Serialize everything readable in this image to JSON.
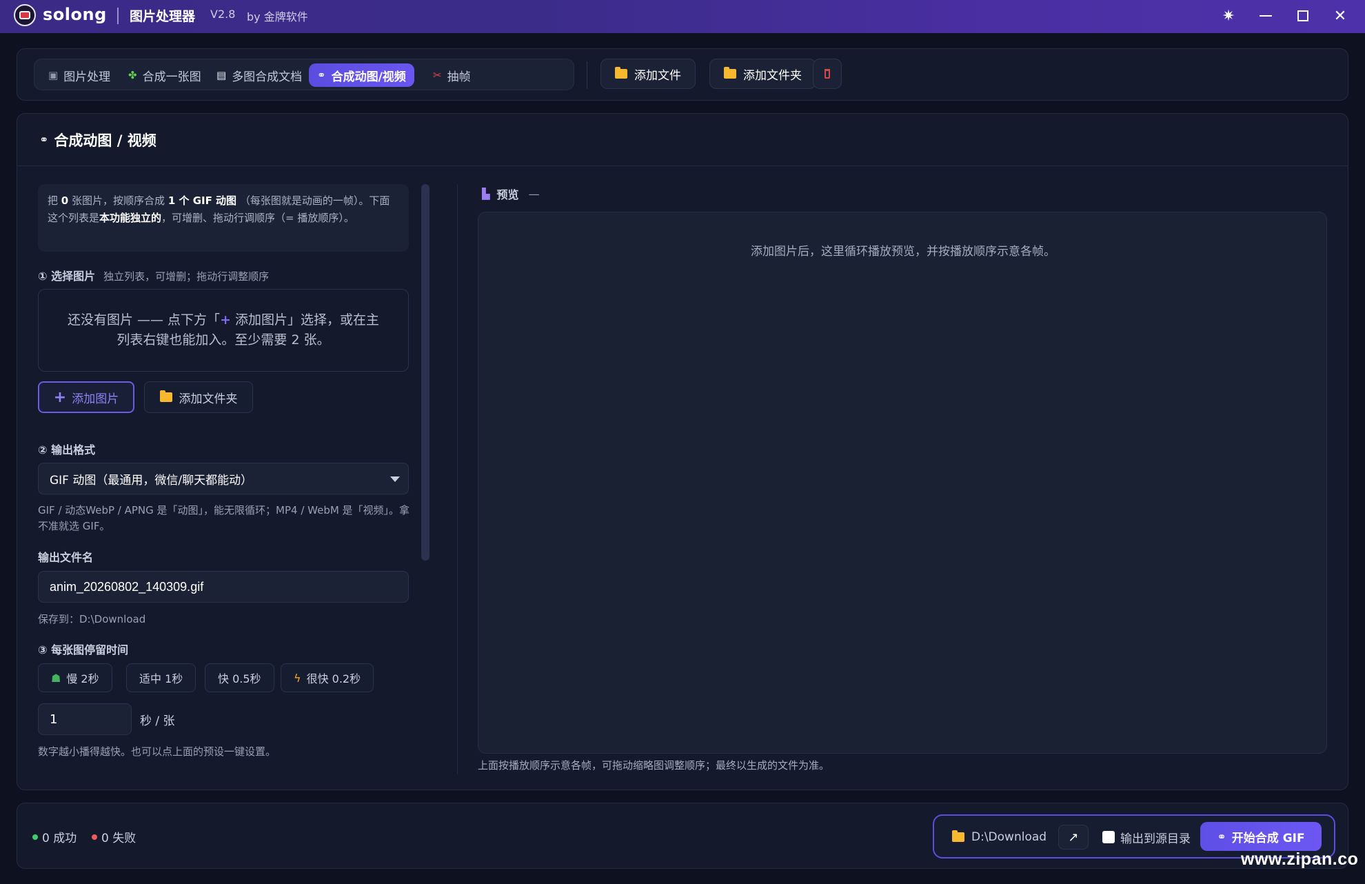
{
  "titlebar": {
    "app_name": "solong",
    "title": "图片处理器",
    "version": "V2.8",
    "by": "by 金牌软件",
    "accent": "#3b2a86"
  },
  "toolbar": {
    "tabs": [
      {
        "label": "图片处理",
        "icon": "image-icon"
      },
      {
        "label": "合成一张图",
        "icon": "puzzle-icon"
      },
      {
        "label": "多图合成文档",
        "icon": "document-icon"
      },
      {
        "label": "合成动图/视频",
        "icon": "link-icon",
        "active": true
      },
      {
        "label": "抽帧",
        "icon": "scissors-icon"
      }
    ],
    "add_file": "添加文件",
    "add_folder": "添加文件夹"
  },
  "main": {
    "title": "合成动图 / 视频",
    "info": {
      "p1": "把",
      "count": "0",
      "p2": "张图片，按顺序合成",
      "target": "1 个 GIF 动图",
      "p3": "（每张图就是动画的一帧）。下面这个列表是",
      "bold2": "本功能独立的",
      "p4": "，可增删、拖动行调顺序（= 播放顺序）。"
    },
    "step1": {
      "label": "① 选择图片",
      "hint": "独立列表，可增删；拖动行调整顺序",
      "empty_a": "还没有图片 —— 点下方「",
      "empty_plus": "+",
      "empty_b": " 添加图片」选择，或在主列表右键也能加入。至少需要 2 张。",
      "add_images": "添加图片",
      "add_folder": "添加文件夹"
    },
    "step2": {
      "label": "② 输出格式",
      "selected": "GIF 动图（最通用，微信/聊天都能动）",
      "note": "GIF / 动态WebP / APNG 是「动图」，能无限循环；MP4 / WebM 是「视频」。拿不准就选 GIF。"
    },
    "filename": {
      "label": "输出文件名",
      "value": "anim_20260802_140309.gif",
      "save_to": "保存到：D:\\Download"
    },
    "step3": {
      "label": "③ 每张图停留时间",
      "presets": [
        "慢 2秒",
        "适中 1秒",
        "快 0.5秒",
        "很快 0.2秒"
      ],
      "value": "1",
      "unit": "秒 / 张",
      "note": "数字越小播得越快。也可以点上面的预设一键设置。"
    },
    "preview": {
      "title": "预览",
      "dash": "—",
      "empty": "添加图片后，这里循环播放预览，并按播放顺序示意各帧。",
      "note": "上面按播放顺序示意各帧，可拖动缩略图调整顺序；最终以生成的文件为准。"
    }
  },
  "status": {
    "success": "0 成功",
    "fail": "0 失败",
    "output_path": "D:\\Download",
    "open_glyph": "↗",
    "to_source": "输出到源目录",
    "start": "开始合成 GIF"
  },
  "watermark": "www.zipan.co"
}
